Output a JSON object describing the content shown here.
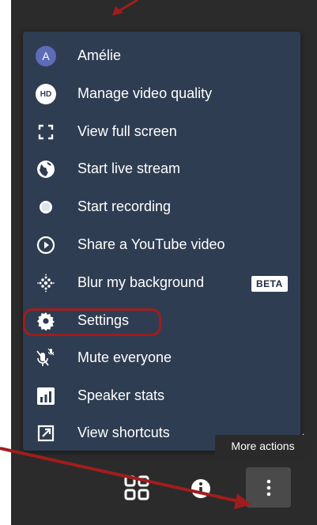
{
  "menu": {
    "items": [
      {
        "label": "Amélie",
        "icon": "avatar-icon",
        "avatar_letter": "A"
      },
      {
        "label": "Manage video quality",
        "icon": "hd-icon",
        "badge_text": "HD"
      },
      {
        "label": "View full screen",
        "icon": "fullscreen-icon"
      },
      {
        "label": "Start live stream",
        "icon": "globe-icon"
      },
      {
        "label": "Start recording",
        "icon": "record-icon"
      },
      {
        "label": "Share a YouTube video",
        "icon": "play-circle-icon"
      },
      {
        "label": "Blur my background",
        "icon": "blur-icon",
        "tag": "BETA"
      },
      {
        "label": "Settings",
        "icon": "gear-icon"
      },
      {
        "label": "Mute everyone",
        "icon": "mute-everyone-icon"
      },
      {
        "label": "Speaker stats",
        "icon": "speaker-stats-icon"
      },
      {
        "label": "View shortcuts",
        "icon": "shortcuts-icon"
      }
    ]
  },
  "tooltip": {
    "text": "More actions"
  },
  "toolbar": {
    "buttons": [
      {
        "name": "tile-view",
        "icon": "tile-view-icon"
      },
      {
        "name": "info",
        "icon": "info-icon"
      },
      {
        "name": "more-actions",
        "icon": "more-vertical-icon"
      }
    ]
  },
  "colors": {
    "menu_bg": "#2f3d52",
    "app_bg": "#2b2b2b",
    "highlight": "#a01d1d",
    "annotation_arrow": "#a01d1d"
  }
}
